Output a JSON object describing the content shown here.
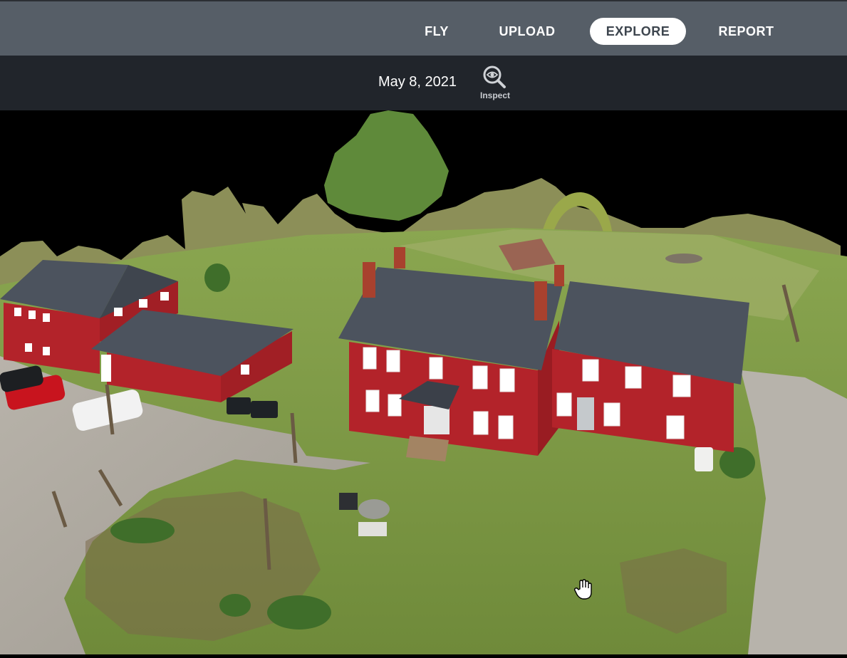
{
  "nav": {
    "items": [
      {
        "label": "FLY"
      },
      {
        "label": "UPLOAD"
      },
      {
        "label": "EXPLORE",
        "active": true
      },
      {
        "label": "REPORT"
      }
    ]
  },
  "toolbar": {
    "date": "May 8, 2021",
    "inspect_label": "Inspect"
  },
  "colors": {
    "nav_bg": "#565e67",
    "toolbar_bg": "#21252b",
    "active_pill": "#ffffff",
    "barn_red": "#b3232a",
    "roof": "#4c535e",
    "grass": "#7a9a3e"
  },
  "icons": {
    "inspect": "magnifier-eye-icon",
    "cursor": "hand-cursor-icon"
  }
}
